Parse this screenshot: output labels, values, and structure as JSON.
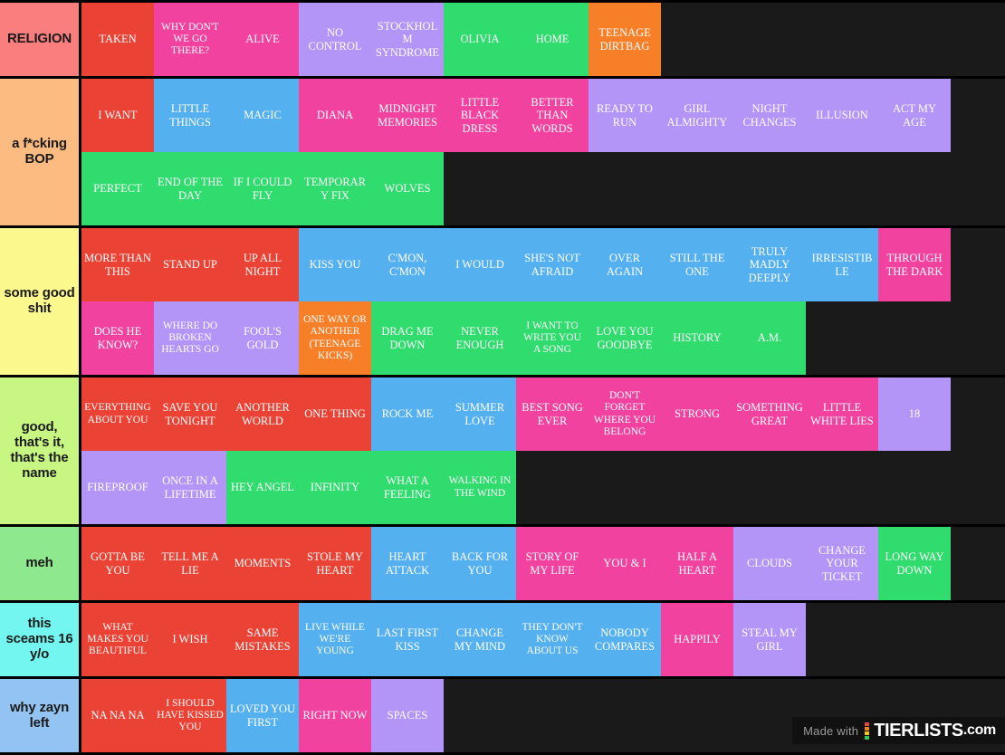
{
  "palette": {
    "red": "#ea4335",
    "pink": "#f0429e",
    "blue": "#55b0ef",
    "green": "#2fdc6d",
    "purple": "#b394f7",
    "orange": "#f77f28",
    "background": "#1a1a1a",
    "border": "#000000",
    "item_text": "#ffffff",
    "label_text": "#1a1a1a"
  },
  "watermark": {
    "made_with": "Made with",
    "brand": "TIERLISTS",
    "suffix": ".com",
    "dot_colors": [
      "#e8483a",
      "#f58220",
      "#f5c518",
      "#35c759"
    ]
  },
  "tiers": [
    {
      "label": "RELIGION",
      "label_color": "#fa7e7e",
      "rows": [
        [
          {
            "text": "TAKEN",
            "color": "#ea4335"
          },
          {
            "text": "WHY DON'T WE GO THERE?",
            "color": "#f0429e"
          },
          {
            "text": "ALIVE",
            "color": "#f0429e"
          },
          {
            "text": "NO CONTROL",
            "color": "#b394f7"
          },
          {
            "text": "STOCKHOLM SYNDROME",
            "color": "#b394f7"
          },
          {
            "text": "OLIVIA",
            "color": "#2fdc6d"
          },
          {
            "text": "HOME",
            "color": "#2fdc6d"
          },
          {
            "text": "TEENAGE DIRTBAG",
            "color": "#f77f28"
          }
        ]
      ]
    },
    {
      "label": "a f*cking BOP",
      "label_color": "#fcbc81",
      "rows": [
        [
          {
            "text": "I WANT",
            "color": "#ea4335"
          },
          {
            "text": "LITTLE THINGS",
            "color": "#55b0ef"
          },
          {
            "text": "MAGIC",
            "color": "#55b0ef"
          },
          {
            "text": "DIANA",
            "color": "#f0429e"
          },
          {
            "text": "MIDNIGHT MEMORIES",
            "color": "#f0429e"
          },
          {
            "text": "LITTLE BLACK DRESS",
            "color": "#f0429e"
          },
          {
            "text": "BETTER THAN WORDS",
            "color": "#f0429e"
          },
          {
            "text": "READY TO RUN",
            "color": "#b394f7"
          },
          {
            "text": "GIRL ALMIGHTY",
            "color": "#b394f7"
          },
          {
            "text": "NIGHT CHANGES",
            "color": "#b394f7"
          },
          {
            "text": "ILLUSION",
            "color": "#b394f7"
          },
          {
            "text": "ACT MY AGE",
            "color": "#b394f7"
          }
        ],
        [
          {
            "text": "PERFECT",
            "color": "#2fdc6d"
          },
          {
            "text": "END OF THE DAY",
            "color": "#2fdc6d"
          },
          {
            "text": "IF I COULD FLY",
            "color": "#2fdc6d"
          },
          {
            "text": "TEMPORARY FIX",
            "color": "#2fdc6d"
          },
          {
            "text": "WOLVES",
            "color": "#2fdc6d"
          }
        ]
      ]
    },
    {
      "label": "some good shit",
      "label_color": "#fbf88e",
      "rows": [
        [
          {
            "text": "MORE THAN THIS",
            "color": "#ea4335"
          },
          {
            "text": "STAND UP",
            "color": "#ea4335"
          },
          {
            "text": "UP ALL NIGHT",
            "color": "#ea4335"
          },
          {
            "text": "KISS YOU",
            "color": "#55b0ef"
          },
          {
            "text": "C'MON, C'MON",
            "color": "#55b0ef"
          },
          {
            "text": "I WOULD",
            "color": "#55b0ef"
          },
          {
            "text": "SHE'S NOT AFRAID",
            "color": "#55b0ef"
          },
          {
            "text": "OVER AGAIN",
            "color": "#55b0ef"
          },
          {
            "text": "STILL THE ONE",
            "color": "#55b0ef"
          },
          {
            "text": "TRULY MADLY DEEPLY",
            "color": "#55b0ef"
          },
          {
            "text": "IRRESISTIBLE",
            "color": "#55b0ef"
          },
          {
            "text": "THROUGH THE DARK",
            "color": "#f0429e"
          }
        ],
        [
          {
            "text": "DOES HE KNOW?",
            "color": "#f0429e"
          },
          {
            "text": "WHERE DO BROKEN HEARTS GO",
            "color": "#b394f7"
          },
          {
            "text": "FOOL'S GOLD",
            "color": "#b394f7"
          },
          {
            "text": "ONE WAY OR ANOTHER (TEENAGE KICKS)",
            "color": "#f77f28"
          },
          {
            "text": "DRAG ME DOWN",
            "color": "#2fdc6d"
          },
          {
            "text": "NEVER ENOUGH",
            "color": "#2fdc6d"
          },
          {
            "text": "I WANT TO WRITE YOU A SONG",
            "color": "#2fdc6d"
          },
          {
            "text": "LOVE YOU GOODBYE",
            "color": "#2fdc6d"
          },
          {
            "text": "HISTORY",
            "color": "#2fdc6d"
          },
          {
            "text": "A.M.",
            "color": "#2fdc6d"
          }
        ]
      ]
    },
    {
      "label": "good, that's it, that's the name",
      "label_color": "#c8f683",
      "rows": [
        [
          {
            "text": "EVERYTHING ABOUT YOU",
            "color": "#ea4335"
          },
          {
            "text": "SAVE YOU TONIGHT",
            "color": "#ea4335"
          },
          {
            "text": "ANOTHER WORLD",
            "color": "#ea4335"
          },
          {
            "text": "ONE THING",
            "color": "#ea4335"
          },
          {
            "text": "ROCK ME",
            "color": "#55b0ef"
          },
          {
            "text": "SUMMER LOVE",
            "color": "#55b0ef"
          },
          {
            "text": "BEST SONG EVER",
            "color": "#f0429e"
          },
          {
            "text": "DON'T FORGET WHERE YOU BELONG",
            "color": "#f0429e"
          },
          {
            "text": "STRONG",
            "color": "#f0429e"
          },
          {
            "text": "SOMETHING GREAT",
            "color": "#f0429e"
          },
          {
            "text": "LITTLE WHITE LIES",
            "color": "#f0429e"
          },
          {
            "text": "18",
            "color": "#b394f7"
          }
        ],
        [
          {
            "text": "FIREPROOF",
            "color": "#b394f7"
          },
          {
            "text": "ONCE IN A LIFETIME",
            "color": "#b394f7"
          },
          {
            "text": "HEY ANGEL",
            "color": "#2fdc6d"
          },
          {
            "text": "INFINITY",
            "color": "#2fdc6d"
          },
          {
            "text": "WHAT A FEELING",
            "color": "#2fdc6d"
          },
          {
            "text": "WALKING IN THE WIND",
            "color": "#2fdc6d"
          }
        ]
      ]
    },
    {
      "label": "meh",
      "label_color": "#8ee88e",
      "rows": [
        [
          {
            "text": "GOTTA BE YOU",
            "color": "#ea4335"
          },
          {
            "text": "TELL ME A LIE",
            "color": "#ea4335"
          },
          {
            "text": "MOMENTS",
            "color": "#ea4335"
          },
          {
            "text": "STOLE MY HEART",
            "color": "#ea4335"
          },
          {
            "text": "HEART ATTACK",
            "color": "#55b0ef"
          },
          {
            "text": "BACK FOR YOU",
            "color": "#55b0ef"
          },
          {
            "text": "STORY OF MY LIFE",
            "color": "#f0429e"
          },
          {
            "text": "YOU & I",
            "color": "#f0429e"
          },
          {
            "text": "HALF A HEART",
            "color": "#f0429e"
          },
          {
            "text": "CLOUDS",
            "color": "#b394f7"
          },
          {
            "text": "CHANGE YOUR TICKET",
            "color": "#b394f7"
          },
          {
            "text": "LONG WAY DOWN",
            "color": "#2fdc6d"
          }
        ]
      ]
    },
    {
      "label": "this sceams 16 y/o",
      "label_color": "#73f6ef",
      "rows": [
        [
          {
            "text": "WHAT MAKES YOU BEAUTIFUL",
            "color": "#ea4335"
          },
          {
            "text": "I WISH",
            "color": "#ea4335"
          },
          {
            "text": "SAME MISTAKES",
            "color": "#ea4335"
          },
          {
            "text": "LIVE WHILE WE'RE YOUNG",
            "color": "#55b0ef"
          },
          {
            "text": "LAST FIRST KISS",
            "color": "#55b0ef"
          },
          {
            "text": "CHANGE MY MIND",
            "color": "#55b0ef"
          },
          {
            "text": "THEY DON'T KNOW ABOUT US",
            "color": "#55b0ef"
          },
          {
            "text": "NOBODY COMPARES",
            "color": "#55b0ef"
          },
          {
            "text": "HAPPILY",
            "color": "#f0429e"
          },
          {
            "text": "STEAL MY GIRL",
            "color": "#b394f7"
          }
        ]
      ]
    },
    {
      "label": "why zayn left",
      "label_color": "#93c3f2",
      "rows": [
        [
          {
            "text": "NA NA NA",
            "color": "#ea4335"
          },
          {
            "text": "I SHOULD HAVE KISSED YOU",
            "color": "#ea4335"
          },
          {
            "text": "LOVED YOU FIRST",
            "color": "#55b0ef"
          },
          {
            "text": "RIGHT NOW",
            "color": "#f0429e"
          },
          {
            "text": "SPACES",
            "color": "#b394f7"
          }
        ]
      ]
    }
  ]
}
